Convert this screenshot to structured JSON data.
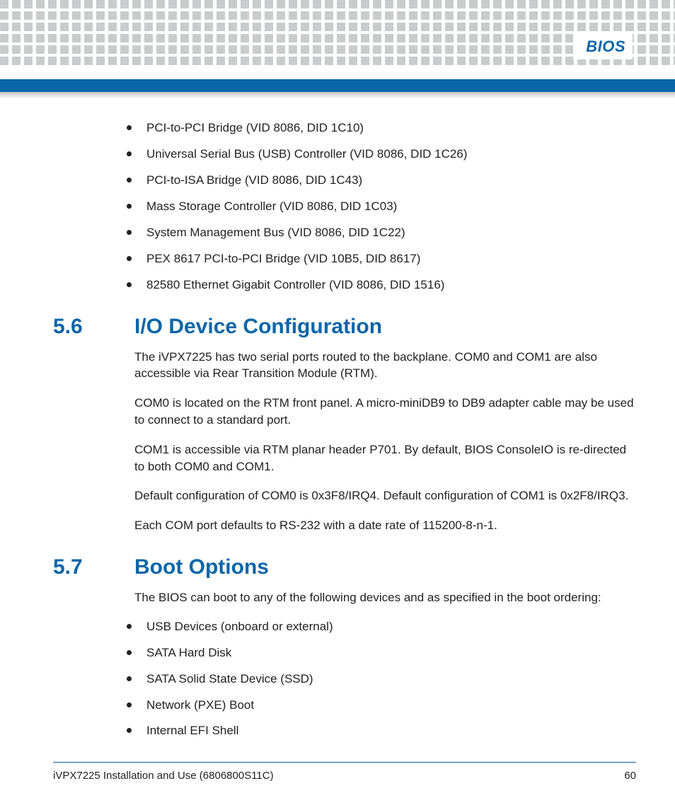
{
  "header": {
    "chapter": "BIOS"
  },
  "top_list": [
    "PCI-to-PCI Bridge (VID 8086, DID 1C10)",
    "Universal Serial Bus (USB) Controller (VID 8086, DID 1C26)",
    "PCI-to-ISA Bridge (VID 8086, DID 1C43)",
    "Mass Storage Controller (VID 8086, DID 1C03)",
    "System Management Bus (VID 8086, DID 1C22)",
    "PEX 8617 PCI-to-PCI Bridge (VID 10B5, DID 8617)",
    "82580 Ethernet Gigabit Controller (VID 8086, DID 1516)"
  ],
  "section56": {
    "num": "5.6",
    "title": "I/O Device Configuration",
    "paras": [
      "The iVPX7225 has two serial ports routed to the backplane. COM0 and COM1 are also accessible via Rear Transition Module (RTM).",
      "COM0 is located on the RTM front panel. A micro-miniDB9 to DB9 adapter cable may be used to connect to a standard port.",
      "COM1 is accessible via RTM planar header P701. By default, BIOS ConsoleIO is re-directed to both COM0 and COM1.",
      "Default configuration of COM0 is 0x3F8/IRQ4. Default configuration of COM1 is 0x2F8/IRQ3.",
      "Each COM port defaults to RS-232 with a date rate of 115200-8-n-1."
    ]
  },
  "section57": {
    "num": "5.7",
    "title": "Boot Options",
    "intro": "The BIOS can boot to any of the following devices and as specified in the boot ordering:",
    "items": [
      "USB Devices (onboard or external)",
      "SATA Hard Disk",
      "SATA Solid State Device (SSD)",
      "Network (PXE) Boot",
      "Internal EFI Shell"
    ]
  },
  "footer": {
    "left": "iVPX7225 Installation and Use (6806800S11C)",
    "right": "60"
  }
}
